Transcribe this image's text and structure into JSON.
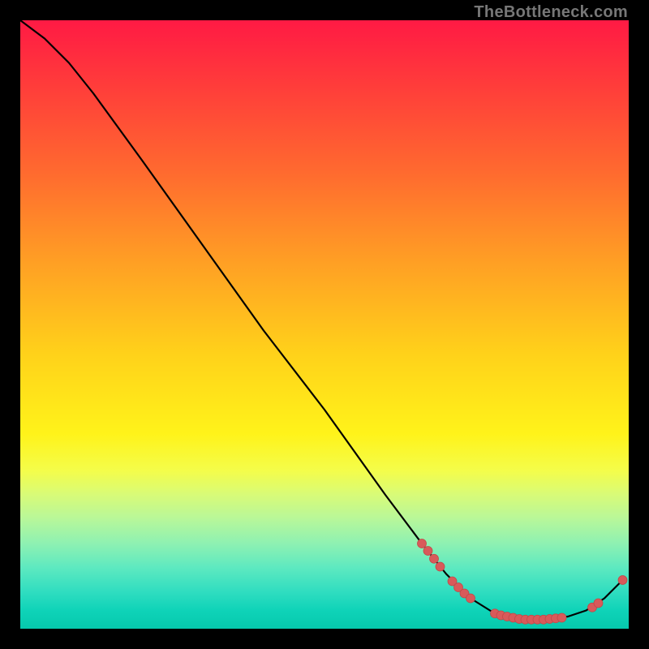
{
  "watermark": "TheBottleneck.com",
  "colors": {
    "curve": "#000000",
    "point_fill": "#d85a5a",
    "point_stroke": "#c24848"
  },
  "chart_data": {
    "type": "line",
    "title": "",
    "xlabel": "",
    "ylabel": "",
    "xlim": [
      0,
      100
    ],
    "ylim": [
      0,
      100
    ],
    "grid": false,
    "legend": false,
    "curve": [
      {
        "x": 0,
        "y": 100
      },
      {
        "x": 4,
        "y": 97
      },
      {
        "x": 8,
        "y": 93
      },
      {
        "x": 12,
        "y": 88
      },
      {
        "x": 20,
        "y": 77
      },
      {
        "x": 30,
        "y": 63
      },
      {
        "x": 40,
        "y": 49
      },
      {
        "x": 50,
        "y": 36
      },
      {
        "x": 60,
        "y": 22
      },
      {
        "x": 66,
        "y": 14
      },
      {
        "x": 70,
        "y": 9
      },
      {
        "x": 74,
        "y": 5
      },
      {
        "x": 78,
        "y": 2.5
      },
      {
        "x": 82,
        "y": 1.5
      },
      {
        "x": 86,
        "y": 1.5
      },
      {
        "x": 90,
        "y": 2
      },
      {
        "x": 93,
        "y": 3
      },
      {
        "x": 96,
        "y": 5
      },
      {
        "x": 99,
        "y": 8
      }
    ],
    "points": [
      {
        "x": 66,
        "y": 14
      },
      {
        "x": 67,
        "y": 12.8
      },
      {
        "x": 68,
        "y": 11.5
      },
      {
        "x": 69,
        "y": 10.2
      },
      {
        "x": 71,
        "y": 7.8
      },
      {
        "x": 72,
        "y": 6.8
      },
      {
        "x": 73,
        "y": 5.8
      },
      {
        "x": 74,
        "y": 5
      },
      {
        "x": 78,
        "y": 2.5
      },
      {
        "x": 79,
        "y": 2.2
      },
      {
        "x": 80,
        "y": 2
      },
      {
        "x": 81,
        "y": 1.8
      },
      {
        "x": 82,
        "y": 1.6
      },
      {
        "x": 83,
        "y": 1.5
      },
      {
        "x": 84,
        "y": 1.5
      },
      {
        "x": 85,
        "y": 1.5
      },
      {
        "x": 86,
        "y": 1.5
      },
      {
        "x": 87,
        "y": 1.6
      },
      {
        "x": 88,
        "y": 1.7
      },
      {
        "x": 89,
        "y": 1.8
      },
      {
        "x": 94,
        "y": 3.5
      },
      {
        "x": 95,
        "y": 4.2
      },
      {
        "x": 99,
        "y": 8
      }
    ]
  }
}
